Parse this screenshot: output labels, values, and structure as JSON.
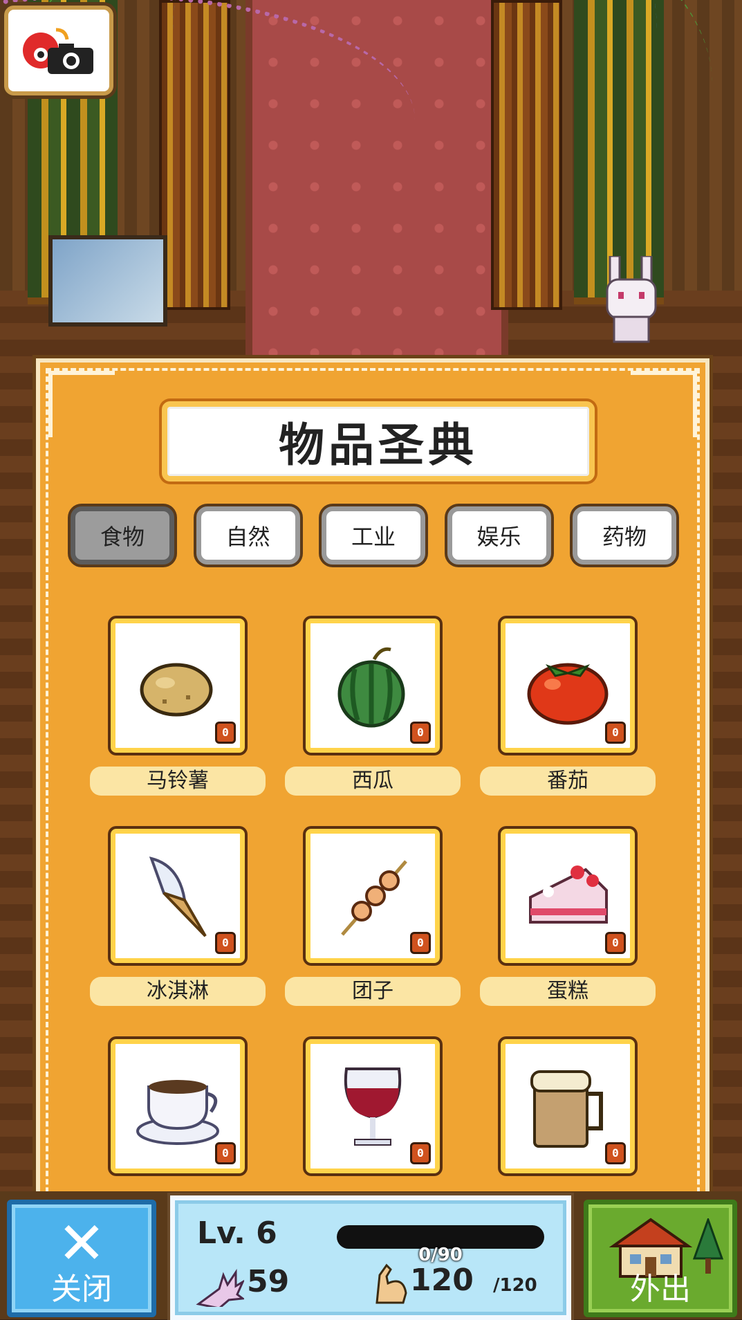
{
  "title": "物品圣典",
  "tabs": [
    {
      "label": "食物",
      "active": true
    },
    {
      "label": "自然",
      "active": false
    },
    {
      "label": "工业",
      "active": false
    },
    {
      "label": "娱乐",
      "active": false
    },
    {
      "label": "药物",
      "active": false
    }
  ],
  "items": [
    {
      "name": "马铃薯",
      "count": "0",
      "icon": "potato-icon"
    },
    {
      "name": "西瓜",
      "count": "0",
      "icon": "watermelon-icon"
    },
    {
      "name": "番茄",
      "count": "0",
      "icon": "tomato-icon"
    },
    {
      "name": "冰淇淋",
      "count": "0",
      "icon": "ice-cream-icon"
    },
    {
      "name": "团子",
      "count": "0",
      "icon": "dango-icon"
    },
    {
      "name": "蛋糕",
      "count": "0",
      "icon": "cake-icon"
    },
    {
      "name": "",
      "count": "0",
      "icon": "coffee-cup-icon"
    },
    {
      "name": "",
      "count": "0",
      "icon": "wine-glass-icon"
    },
    {
      "name": "",
      "count": "0",
      "icon": "beer-mug-icon"
    }
  ],
  "bottom": {
    "close_label": "关闭",
    "close_symbol": "✕",
    "level": "Lv. 6",
    "exp": "0/90",
    "exp_progress": 0,
    "hand_value": "59",
    "strength_value": "120",
    "strength_max": "/120",
    "out_label": "外出"
  },
  "colors": {
    "panel": "#f0a432",
    "close_button": "#4cb2ec",
    "out_button": "#6aaa2e",
    "status_panel": "#b8e6f8"
  }
}
